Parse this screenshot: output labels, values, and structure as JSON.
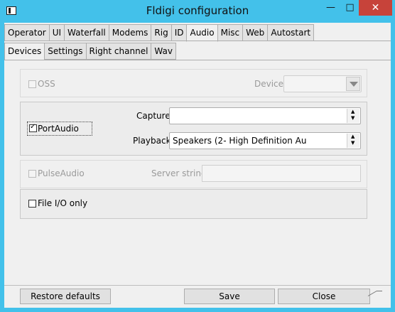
{
  "window": {
    "title": "Fldigi configuration",
    "minimize": "—",
    "maximize": "□",
    "close": "✕"
  },
  "tabs_top": [
    "Operator",
    "UI",
    "Waterfall",
    "Modems",
    "Rig",
    "ID",
    "Audio",
    "Misc",
    "Web",
    "Autostart"
  ],
  "tabs_top_active": "Audio",
  "tabs_sub": [
    "Devices",
    "Settings",
    "Right channel",
    "Wav"
  ],
  "tabs_sub_active": "Devices",
  "oss": {
    "label": "OSS",
    "checked": false,
    "device_label": "Device:",
    "device_value": ""
  },
  "portaudio": {
    "label": "PortAudio",
    "checked": true,
    "capture_label": "Capture:",
    "capture_value": "",
    "playback_label": "Playback:",
    "playback_value": "Speakers (2- High Definition Au"
  },
  "pulseaudio": {
    "label": "PulseAudio",
    "checked": false,
    "server_label": "Server string:",
    "server_value": ""
  },
  "fileio": {
    "label": "File I/O only",
    "checked": false
  },
  "buttons": {
    "restore": "Restore defaults",
    "save": "Save",
    "close": "Close"
  }
}
